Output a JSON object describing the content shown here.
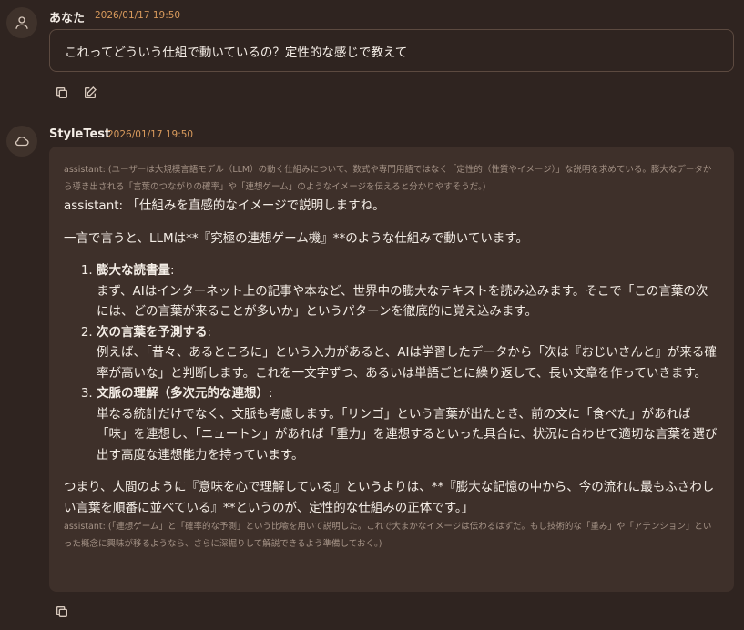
{
  "user_message": {
    "sender": "あなた",
    "timestamp": "2026/01/17 19:50",
    "text": "これってどういう仕組で動いているの？定性的な感じで教えて",
    "actions": [
      "copy-icon",
      "edit-icon"
    ]
  },
  "bot_message": {
    "sender": "StyleTest",
    "timestamp": "2026/01/17 19:50",
    "note_top": "assistant: (ユーザーは大規模言語モデル（LLM）の動く仕組みについて、数式や専門用語ではなく「定性的（性質やイメージ）」な説明を求めている。膨大なデータから導き出される「言葉のつながりの確率」や「連想ゲーム」のようなイメージを伝えると分かりやすそうだ。)",
    "intro": "assistant: 「仕組みを直感的なイメージで説明しますね。",
    "summary": "一言で言うと、LLMは**『究極の連想ゲーム機』**のような仕組みで動いています。",
    "items": [
      {
        "title": "膨大な読書量",
        "suffix": ":",
        "body": "まず、AIはインターネット上の記事や本など、世界中の膨大なテキストを読み込みます。そこで「この言葉の次には、どの言葉が来ることが多いか」というパターンを徹底的に覚え込みます。"
      },
      {
        "title": "次の言葉を予測する",
        "suffix": ":",
        "body": "例えば、「昔々、あるところに」という入力があると、AIは学習したデータから「次は『おじいさんと』が来る確率が高いな」と判断します。これを一文字ずつ、あるいは単語ごとに繰り返して、長い文章を作っていきます。"
      },
      {
        "title": "文脈の理解（多次元的な連想）",
        "suffix": ":",
        "body": "単なる統計だけでなく、文脈も考慮します。「リンゴ」という言葉が出たとき、前の文に「食べた」があれば「味」を連想し、「ニュートン」があれば「重力」を連想するといった具合に、状況に合わせて適切な言葉を選び出す高度な連想能力を持っています。"
      }
    ],
    "conclusion": "つまり、人間のように『意味を心で理解している』というよりは、**『膨大な記憶の中から、今の流れに最もふさわしい言葉を順番に並べている』**というのが、定性的な仕組みの正体です。」",
    "note_bottom": "assistant: (「連想ゲーム」と「確率的な予測」という比喩を用いて説明した。これで大まかなイメージは伝わるはずだ。もし技術的な「重み」や「アテンション」といった概念に興味が移るようなら、さらに深掘りして解説できるよう準備しておく。)",
    "actions": [
      "copy-icon"
    ]
  },
  "colors": {
    "background": "#2f2420",
    "bubble": "#3e302a",
    "timestamp": "#d89a5c",
    "note": "#a59387"
  }
}
